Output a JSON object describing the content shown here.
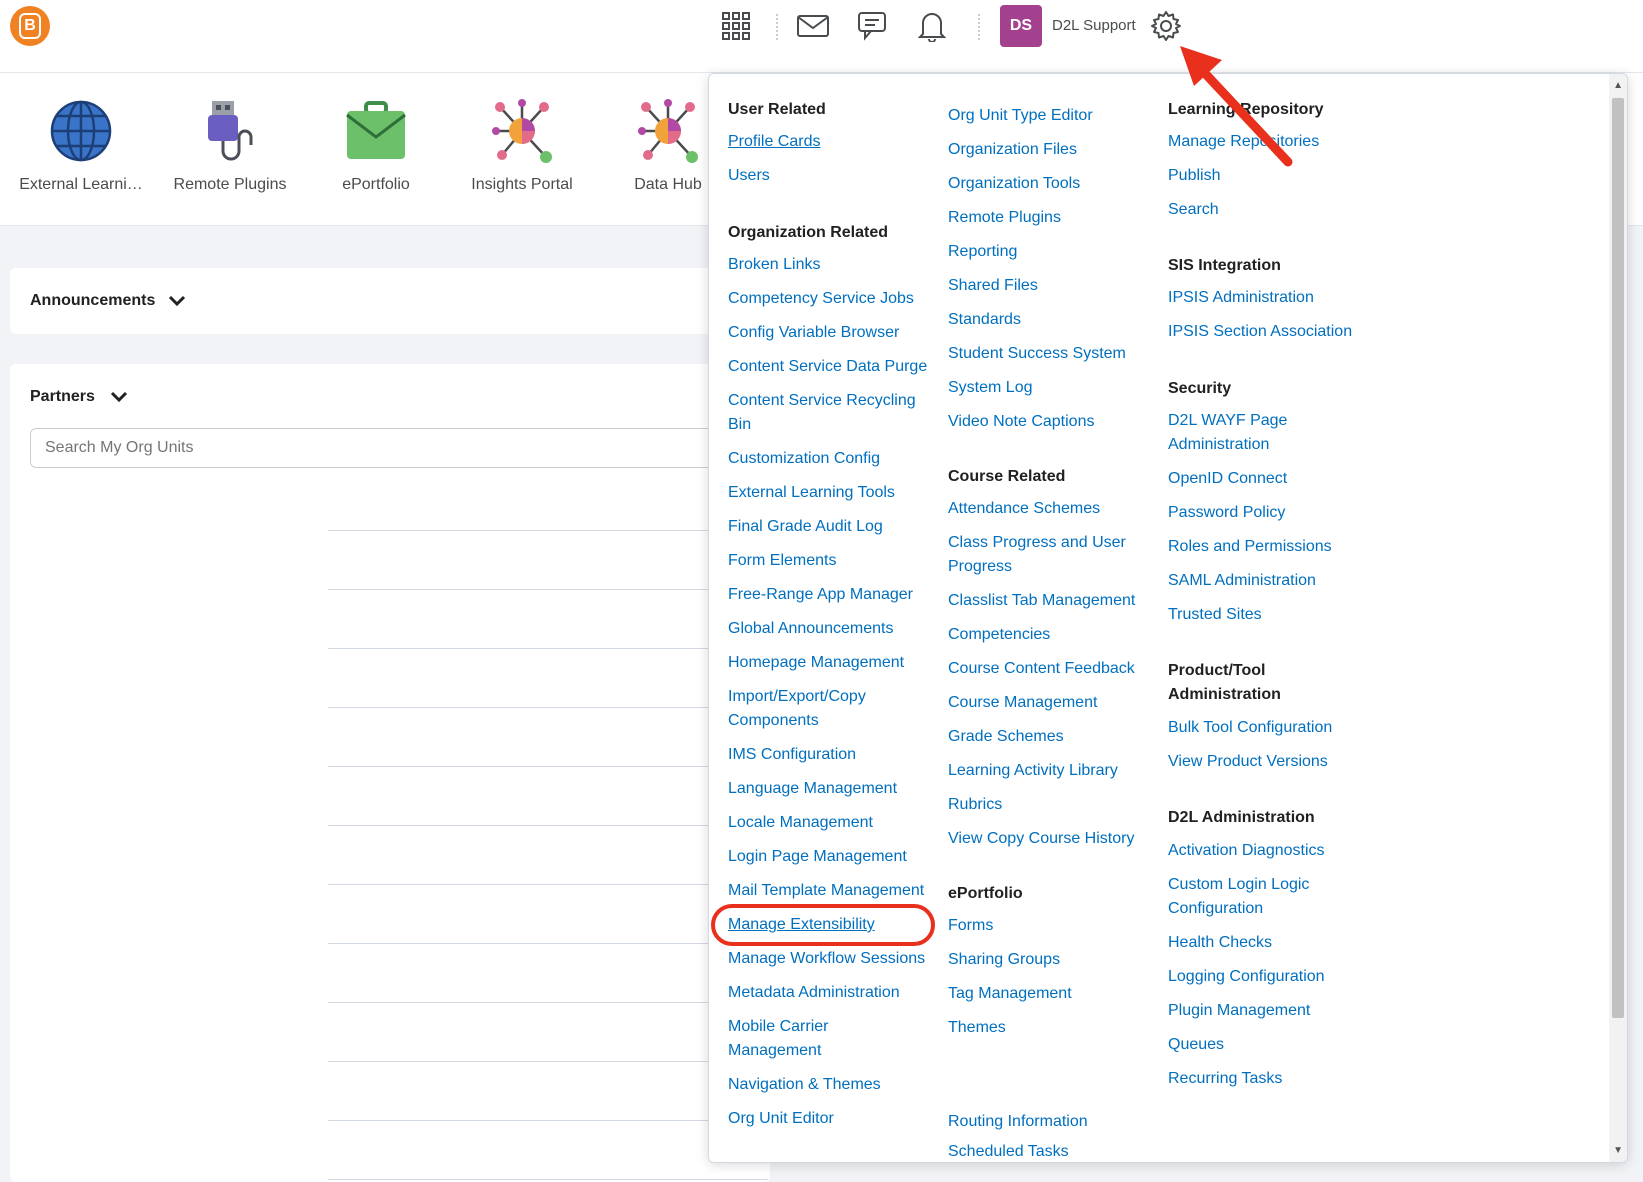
{
  "header": {
    "logo_letter": "B",
    "avatar_initials": "DS",
    "username": "D2L Support",
    "icons": [
      "app-grid-icon",
      "mail-icon",
      "chat-icon",
      "bell-icon",
      "gear-icon"
    ],
    "avatar_color": "#a3418f",
    "brand_color": "#f08223"
  },
  "tools": [
    {
      "label": "External Learni…",
      "icon": "globe-icon"
    },
    {
      "label": "Remote Plugins",
      "icon": "plug-icon"
    },
    {
      "label": "ePortfolio",
      "icon": "briefcase-icon"
    },
    {
      "label": "Insights Portal",
      "icon": "network-icon"
    },
    {
      "label": "Data Hub",
      "icon": "network-icon"
    }
  ],
  "widgets": {
    "announcements": "Announcements",
    "partners": "Partners",
    "search_placeholder": "Search My Org Units"
  },
  "menu": {
    "col1": {
      "user_related": "User Related",
      "profile_cards": "Profile Cards",
      "users": "Users",
      "org_related": "Organization Related",
      "items": [
        "Broken Links",
        "Competency Service Jobs",
        "Config Variable Browser",
        "Content Service Data Purge",
        "Content Service Recycling",
        "Bin",
        "Customization Config",
        "External Learning Tools",
        "Final Grade Audit Log",
        "Form Elements",
        "Free-Range App Manager",
        "Global Announcements",
        "Homepage Management",
        "Import/Export/Copy",
        "Components",
        "IMS Configuration",
        "Language Management",
        "Locale Management",
        "Login Page Management",
        "Mail Template Management",
        "Manage Extensibility",
        "Manage Workflow Sessions",
        "Metadata Administration",
        "Mobile Carrier",
        "Management",
        "Navigation & Themes",
        "Org Unit Editor"
      ]
    },
    "col2": {
      "items_top": [
        "Org Unit Type Editor",
        "Organization Files",
        "Organization Tools",
        "Remote Plugins",
        "Reporting",
        "Shared Files",
        "Standards",
        "Student Success System",
        "System Log",
        "Video Note Captions"
      ],
      "course_related": "Course Related",
      "course_items": [
        "Attendance Schemes",
        "Class Progress and User",
        "Progress",
        "Classlist Tab Management",
        "Competencies",
        "Course Content Feedback",
        "Course Management",
        "Grade Schemes",
        "Learning Activity Library",
        "Rubrics",
        "View Copy Course History"
      ],
      "eportfolio": "ePortfolio",
      "eportfolio_items": [
        "Forms",
        "Sharing Groups",
        "Tag Management",
        "Themes"
      ],
      "bottom_items": [
        "Routing Information",
        "Scheduled Tasks"
      ]
    },
    "col3": {
      "learning_repo": "Learning Repository",
      "repo_items": [
        "Manage Repositories",
        "Publish",
        "Search"
      ],
      "sis": "SIS Integration",
      "sis_items": [
        "IPSIS Administration",
        "IPSIS Section Association"
      ],
      "security": "Security",
      "security_items": [
        "D2L WAYF Page",
        "Administration",
        "OpenID Connect",
        "Password Policy",
        "Roles and Permissions",
        "SAML Administration",
        "Trusted Sites"
      ],
      "product_tool": "Product/Tool",
      "product_tool_2": "Administration",
      "product_items": [
        "Bulk Tool Configuration",
        "View Product Versions"
      ],
      "d2l_admin": "D2L Administration",
      "d2l_items": [
        "Activation Diagnostics",
        "Custom Login Logic",
        "Configuration",
        "Health Checks",
        "Logging Configuration",
        "Plugin Management",
        "Queues",
        "Recurring Tasks"
      ]
    }
  },
  "annotation_color": "#e8301c",
  "link_color": "#006fbf"
}
